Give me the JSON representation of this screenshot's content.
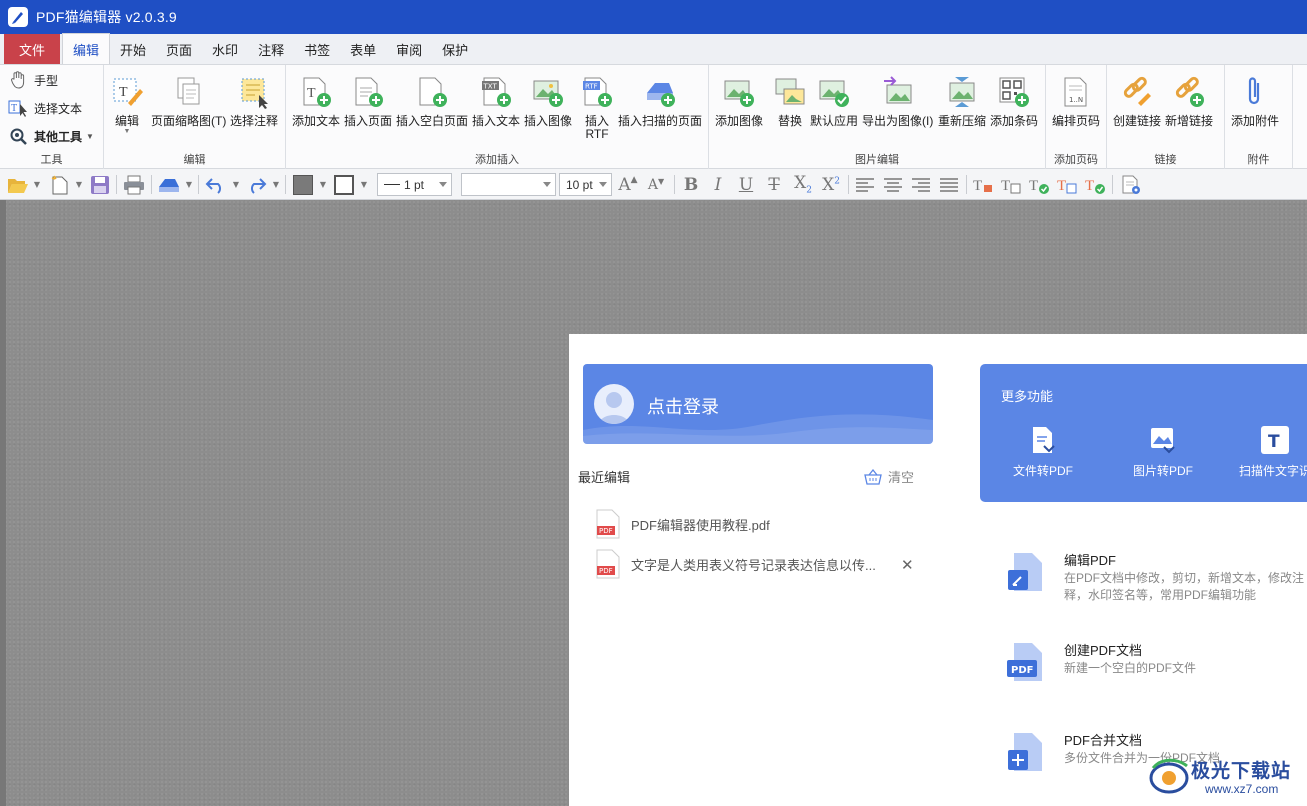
{
  "app": {
    "title": "PDF猫编辑器 v2.0.3.9"
  },
  "menu": [
    "文件",
    "编辑",
    "开始",
    "页面",
    "水印",
    "注释",
    "书签",
    "表单",
    "审阅",
    "保护"
  ],
  "ribbon": {
    "tools": {
      "hand": "手型",
      "select_text": "选择文本",
      "other_tools": "其他工具",
      "group": "工具"
    },
    "edit_group": {
      "edit": "编辑",
      "thumbnails": "页面缩略图(T)",
      "select_annot": "选择注释",
      "group": "编辑"
    },
    "insert_group": {
      "add_text": "添加文本",
      "insert_page": "插入页面",
      "insert_blank": "插入空白页面",
      "insert_text": "插入文本",
      "insert_image": "插入图像",
      "insert_rtf": "插入\nRTF",
      "insert_scan": "插入扫描的页面",
      "group": "添加插入"
    },
    "image_group": {
      "add_image": "添加图像",
      "replace": "替换",
      "default_apply": "默认应用",
      "export_image": "导出为图像(I)",
      "recompress": "重新压缩",
      "add_barcode": "添加条码",
      "group": "图片编辑"
    },
    "pagenum_group": {
      "pagenum": "编排页码",
      "group": "添加页码"
    },
    "link_group": {
      "create_link": "创建链接",
      "add_link": "新增链接",
      "group": "链接"
    },
    "attach_group": {
      "add_attach": "添加附件",
      "group": "附件"
    }
  },
  "quickbar": {
    "line_width": "1 pt",
    "font": "",
    "font_size": "10 pt"
  },
  "start": {
    "login": "点击登录",
    "recent_title": "最近编辑",
    "clear": "清空",
    "recent": [
      "PDF编辑器使用教程.pdf",
      "文字是人类用表义符号记录表达信息以传..."
    ],
    "more": {
      "title": "更多功能",
      "items": [
        "文件转PDF",
        "图片转PDF",
        "扫描件文字识"
      ]
    },
    "features": [
      {
        "title": "编辑PDF",
        "desc": "在PDF文档中修改，剪切，新增文本，修改注释，水印签名等，常用PDF编辑功能"
      },
      {
        "title": "创建PDF文档",
        "desc": "新建一个空白的PDF文件"
      },
      {
        "title": "PDF合并文档",
        "desc": "多份文件合并为一份PDF文档"
      }
    ]
  },
  "watermark": {
    "text": "极光下载站",
    "url": "www.xz7.com"
  },
  "colors": {
    "titlebar": "#1f4fc4",
    "file_tab": "#c9424a",
    "card": "#5b86e5",
    "icon_green": "#3fb25b"
  }
}
